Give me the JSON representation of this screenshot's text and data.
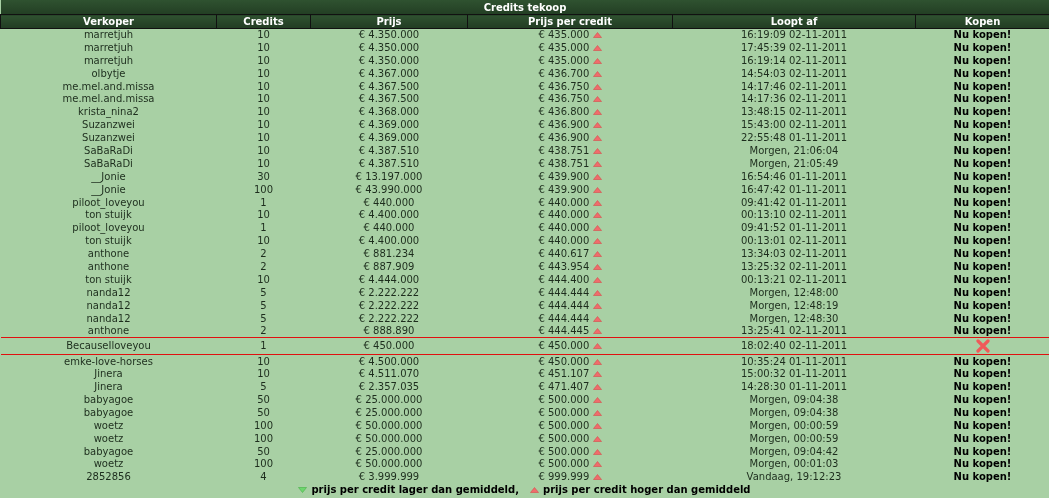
{
  "title": "Credits tekoop",
  "columns": [
    "Verkoper",
    "Credits",
    "Prijs",
    "Prijs per credit",
    "Loopt af",
    "Kopen"
  ],
  "rows": [
    {
      "seller": "marretjuh",
      "credits": "10",
      "price": "€ 4.350.000",
      "price_per_credit": "€ 435.000",
      "above_average": true,
      "expires": "16:19:09 02-11-2011",
      "own": false,
      "buy": "Nu kopen!"
    },
    {
      "seller": "marretjuh",
      "credits": "10",
      "price": "€ 4.350.000",
      "price_per_credit": "€ 435.000",
      "above_average": true,
      "expires": "17:45:39 02-11-2011",
      "own": false,
      "buy": "Nu kopen!"
    },
    {
      "seller": "marretjuh",
      "credits": "10",
      "price": "€ 4.350.000",
      "price_per_credit": "€ 435.000",
      "above_average": true,
      "expires": "16:19:14 02-11-2011",
      "own": false,
      "buy": "Nu kopen!"
    },
    {
      "seller": "olbytje",
      "credits": "10",
      "price": "€ 4.367.000",
      "price_per_credit": "€ 436.700",
      "above_average": true,
      "expires": "14:54:03 02-11-2011",
      "own": false,
      "buy": "Nu kopen!"
    },
    {
      "seller": "me.mel.and.missa",
      "credits": "10",
      "price": "€ 4.367.500",
      "price_per_credit": "€ 436.750",
      "above_average": true,
      "expires": "14:17:46 02-11-2011",
      "own": false,
      "buy": "Nu kopen!"
    },
    {
      "seller": "me.mel.and.missa",
      "credits": "10",
      "price": "€ 4.367.500",
      "price_per_credit": "€ 436.750",
      "above_average": true,
      "expires": "14:17:36 02-11-2011",
      "own": false,
      "buy": "Nu kopen!"
    },
    {
      "seller": "krista_nina2",
      "credits": "10",
      "price": "€ 4.368.000",
      "price_per_credit": "€ 436.800",
      "above_average": true,
      "expires": "13:48:15 02-11-2011",
      "own": false,
      "buy": "Nu kopen!"
    },
    {
      "seller": "Suzanzwei",
      "credits": "10",
      "price": "€ 4.369.000",
      "price_per_credit": "€ 436.900",
      "above_average": true,
      "expires": "15:43:00 02-11-2011",
      "own": false,
      "buy": "Nu kopen!"
    },
    {
      "seller": "Suzanzwei",
      "credits": "10",
      "price": "€ 4.369.000",
      "price_per_credit": "€ 436.900",
      "above_average": true,
      "expires": "22:55:48 01-11-2011",
      "own": false,
      "buy": "Nu kopen!"
    },
    {
      "seller": "SaBaRaDi",
      "credits": "10",
      "price": "€ 4.387.510",
      "price_per_credit": "€ 438.751",
      "above_average": true,
      "expires": "Morgen, 21:06:04",
      "own": false,
      "buy": "Nu kopen!"
    },
    {
      "seller": "SaBaRaDi",
      "credits": "10",
      "price": "€ 4.387.510",
      "price_per_credit": "€ 438.751",
      "above_average": true,
      "expires": "Morgen, 21:05:49",
      "own": false,
      "buy": "Nu kopen!"
    },
    {
      "seller": "__Jonie",
      "credits": "30",
      "price": "€ 13.197.000",
      "price_per_credit": "€ 439.900",
      "above_average": true,
      "expires": "16:54:46 01-11-2011",
      "own": false,
      "buy": "Nu kopen!"
    },
    {
      "seller": "__Jonie",
      "credits": "100",
      "price": "€ 43.990.000",
      "price_per_credit": "€ 439.900",
      "above_average": true,
      "expires": "16:47:42 01-11-2011",
      "own": false,
      "buy": "Nu kopen!"
    },
    {
      "seller": "piloot_loveyou",
      "credits": "1",
      "price": "€ 440.000",
      "price_per_credit": "€ 440.000",
      "above_average": true,
      "expires": "09:41:42 01-11-2011",
      "own": false,
      "buy": "Nu kopen!"
    },
    {
      "seller": "ton stuijk",
      "credits": "10",
      "price": "€ 4.400.000",
      "price_per_credit": "€ 440.000",
      "above_average": true,
      "expires": "00:13:10 02-11-2011",
      "own": false,
      "buy": "Nu kopen!"
    },
    {
      "seller": "piloot_loveyou",
      "credits": "1",
      "price": "€ 440.000",
      "price_per_credit": "€ 440.000",
      "above_average": true,
      "expires": "09:41:52 01-11-2011",
      "own": false,
      "buy": "Nu kopen!"
    },
    {
      "seller": "ton stuijk",
      "credits": "10",
      "price": "€ 4.400.000",
      "price_per_credit": "€ 440.000",
      "above_average": true,
      "expires": "00:13:01 02-11-2011",
      "own": false,
      "buy": "Nu kopen!"
    },
    {
      "seller": "anthone",
      "credits": "2",
      "price": "€ 881.234",
      "price_per_credit": "€ 440.617",
      "above_average": true,
      "expires": "13:34:03 02-11-2011",
      "own": false,
      "buy": "Nu kopen!"
    },
    {
      "seller": "anthone",
      "credits": "2",
      "price": "€ 887.909",
      "price_per_credit": "€ 443.954",
      "above_average": true,
      "expires": "13:25:32 02-11-2011",
      "own": false,
      "buy": "Nu kopen!"
    },
    {
      "seller": "ton stuijk",
      "credits": "10",
      "price": "€ 4.444.000",
      "price_per_credit": "€ 444.400",
      "above_average": true,
      "expires": "00:13:21 02-11-2011",
      "own": false,
      "buy": "Nu kopen!"
    },
    {
      "seller": "nanda12",
      "credits": "5",
      "price": "€ 2.222.222",
      "price_per_credit": "€ 444.444",
      "above_average": true,
      "expires": "Morgen, 12:48:00",
      "own": false,
      "buy": "Nu kopen!"
    },
    {
      "seller": "nanda12",
      "credits": "5",
      "price": "€ 2.222.222",
      "price_per_credit": "€ 444.444",
      "above_average": true,
      "expires": "Morgen, 12:48:19",
      "own": false,
      "buy": "Nu kopen!"
    },
    {
      "seller": "nanda12",
      "credits": "5",
      "price": "€ 2.222.222",
      "price_per_credit": "€ 444.444",
      "above_average": true,
      "expires": "Morgen, 12:48:30",
      "own": false,
      "buy": "Nu kopen!"
    },
    {
      "seller": "anthone",
      "credits": "2",
      "price": "€ 888.890",
      "price_per_credit": "€ 444.445",
      "above_average": true,
      "expires": "13:25:41 02-11-2011",
      "own": false,
      "buy": "Nu kopen!"
    },
    {
      "seller": "BecauseIloveyou",
      "credits": "1",
      "price": "€ 450.000",
      "price_per_credit": "€ 450.000",
      "above_average": true,
      "expires": "18:02:40 02-11-2011",
      "own": true
    },
    {
      "seller": "emke-love-horses",
      "credits": "10",
      "price": "€ 4.500.000",
      "price_per_credit": "€ 450.000",
      "above_average": true,
      "expires": "10:35:24 01-11-2011",
      "own": false,
      "buy": "Nu kopen!"
    },
    {
      "seller": "Jinera",
      "credits": "10",
      "price": "€ 4.511.070",
      "price_per_credit": "€ 451.107",
      "above_average": true,
      "expires": "15:00:32 01-11-2011",
      "own": false,
      "buy": "Nu kopen!"
    },
    {
      "seller": "Jinera",
      "credits": "5",
      "price": "€ 2.357.035",
      "price_per_credit": "€ 471.407",
      "above_average": true,
      "expires": "14:28:30 01-11-2011",
      "own": false,
      "buy": "Nu kopen!"
    },
    {
      "seller": "babyagoe",
      "credits": "50",
      "price": "€ 25.000.000",
      "price_per_credit": "€ 500.000",
      "above_average": true,
      "expires": "Morgen, 09:04:38",
      "own": false,
      "buy": "Nu kopen!"
    },
    {
      "seller": "babyagoe",
      "credits": "50",
      "price": "€ 25.000.000",
      "price_per_credit": "€ 500.000",
      "above_average": true,
      "expires": "Morgen, 09:04:38",
      "own": false,
      "buy": "Nu kopen!"
    },
    {
      "seller": "woetz",
      "credits": "100",
      "price": "€ 50.000.000",
      "price_per_credit": "€ 500.000",
      "above_average": true,
      "expires": "Morgen, 00:00:59",
      "own": false,
      "buy": "Nu kopen!"
    },
    {
      "seller": "woetz",
      "credits": "100",
      "price": "€ 50.000.000",
      "price_per_credit": "€ 500.000",
      "above_average": true,
      "expires": "Morgen, 00:00:59",
      "own": false,
      "buy": "Nu kopen!"
    },
    {
      "seller": "babyagoe",
      "credits": "50",
      "price": "€ 25.000.000",
      "price_per_credit": "€ 500.000",
      "above_average": true,
      "expires": "Morgen, 09:04:42",
      "own": false,
      "buy": "Nu kopen!"
    },
    {
      "seller": "woetz",
      "credits": "100",
      "price": "€ 50.000.000",
      "price_per_credit": "€ 500.000",
      "above_average": true,
      "expires": "Morgen, 00:01:03",
      "own": false,
      "buy": "Nu kopen!"
    },
    {
      "seller": "2852856",
      "credits": "4",
      "price": "€ 3.999.999",
      "price_per_credit": "€ 999.999",
      "above_average": true,
      "expires": "Vandaag, 19:12:23",
      "own": false,
      "buy": "Nu kopen!"
    }
  ],
  "legend": [
    {
      "above_average": false,
      "text": "prijs per credit lager dan gemiddeld,"
    },
    {
      "above_average": true,
      "text": "prijs per credit hoger dan gemiddeld"
    }
  ]
}
